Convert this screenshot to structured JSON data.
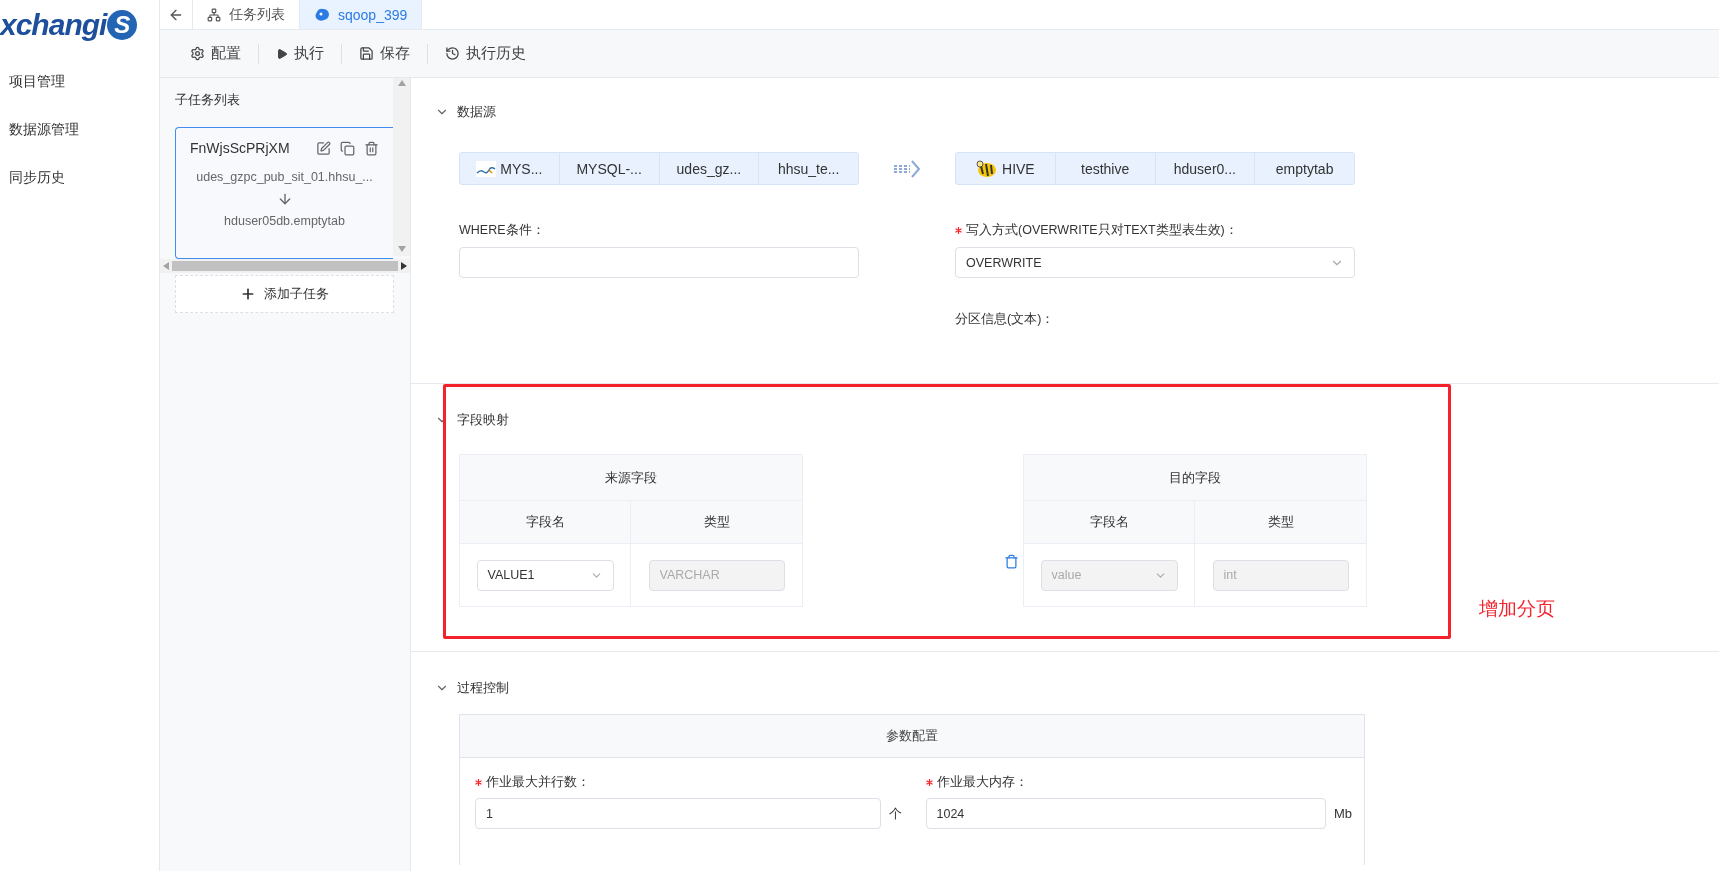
{
  "logo": {
    "text": "xchangi",
    "badge": "S"
  },
  "nav": [
    {
      "label": "项目管理"
    },
    {
      "label": "数据源管理"
    },
    {
      "label": "同步历史"
    }
  ],
  "tabs": [
    {
      "label": "任务列表",
      "selected": false
    },
    {
      "label": "sqoop_399",
      "selected": true
    }
  ],
  "toolbar": [
    {
      "label": "配置"
    },
    {
      "label": "执行"
    },
    {
      "label": "保存"
    },
    {
      "label": "执行历史"
    }
  ],
  "subtasks": {
    "title": "子任务列表",
    "add_label": "添加子任务",
    "items": [
      {
        "name": "FnWjsScPRjXM",
        "source": "udes_gzpc_pub_sit_01.hhsu_...",
        "target": "hduser05db.emptytab",
        "selected": true
      }
    ]
  },
  "datasource": {
    "title": "数据源",
    "expanded": true,
    "source_chips": [
      {
        "label": "MYS..."
      },
      {
        "label": "MYSQL-..."
      },
      {
        "label": "udes_gz..."
      },
      {
        "label": "hhsu_te..."
      }
    ],
    "target_chips": [
      {
        "label": "HIVE"
      },
      {
        "label": "testhive"
      },
      {
        "label": "hduser0..."
      },
      {
        "label": "emptytab"
      }
    ],
    "where": {
      "label": "WHERE条件："
    },
    "write_mode": {
      "label": "写入方式(OVERWRITE只对TEXT类型表生效)：",
      "required": true,
      "value": "OVERWRITE"
    },
    "partition": {
      "label": "分区信息(文本)："
    }
  },
  "field_mapping": {
    "title": "字段映射",
    "expanded": true,
    "source": {
      "title": "来源字段",
      "columns": [
        "字段名",
        "类型"
      ],
      "rows": [
        {
          "name": {
            "value": "VALUE1",
            "disabled": false
          },
          "type": {
            "value": "VARCHAR",
            "disabled": true
          }
        }
      ]
    },
    "target": {
      "title": "目的字段",
      "columns": [
        "字段名",
        "类型"
      ],
      "rows": [
        {
          "name": {
            "value": "value",
            "disabled": true
          },
          "type": {
            "value": "int",
            "disabled": true
          }
        }
      ]
    }
  },
  "annotation": {
    "text": "增加分页"
  },
  "process_control": {
    "title": "过程控制",
    "expanded": true,
    "panel_title": "参数配置",
    "fields": [
      {
        "label": "作业最大并行数：",
        "required": true,
        "value": "1",
        "unit": "个"
      },
      {
        "label": "作业最大内存：",
        "required": true,
        "value": "1024",
        "unit": "Mb"
      }
    ]
  }
}
